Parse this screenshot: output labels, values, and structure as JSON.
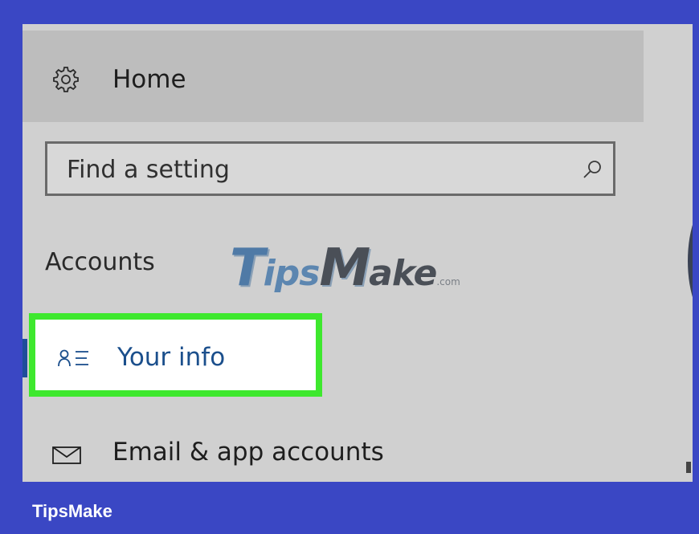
{
  "home": {
    "icon": "gear-icon",
    "label": "Home"
  },
  "search": {
    "placeholder": "Find a setting",
    "icon": "search-icon"
  },
  "section": {
    "heading": "Accounts"
  },
  "nav": {
    "items": [
      {
        "label": "Your info",
        "icon": "person-list-icon",
        "selected": true,
        "highlight_color": "#3ee82e"
      },
      {
        "label": "Email & app accounts",
        "icon": "mail-icon",
        "selected": false
      }
    ]
  },
  "watermark": {
    "part1": "T",
    "part2": "ips",
    "part3": "M",
    "part4": "ake",
    "suffix": ".com"
  },
  "footer": {
    "brand": "TipsMake"
  },
  "colors": {
    "background": "#3a47c4",
    "panel": "#d0d0d0",
    "home_row": "#bdbdbd",
    "accent_text": "#1b4f8c",
    "highlight": "#3ee82e"
  }
}
